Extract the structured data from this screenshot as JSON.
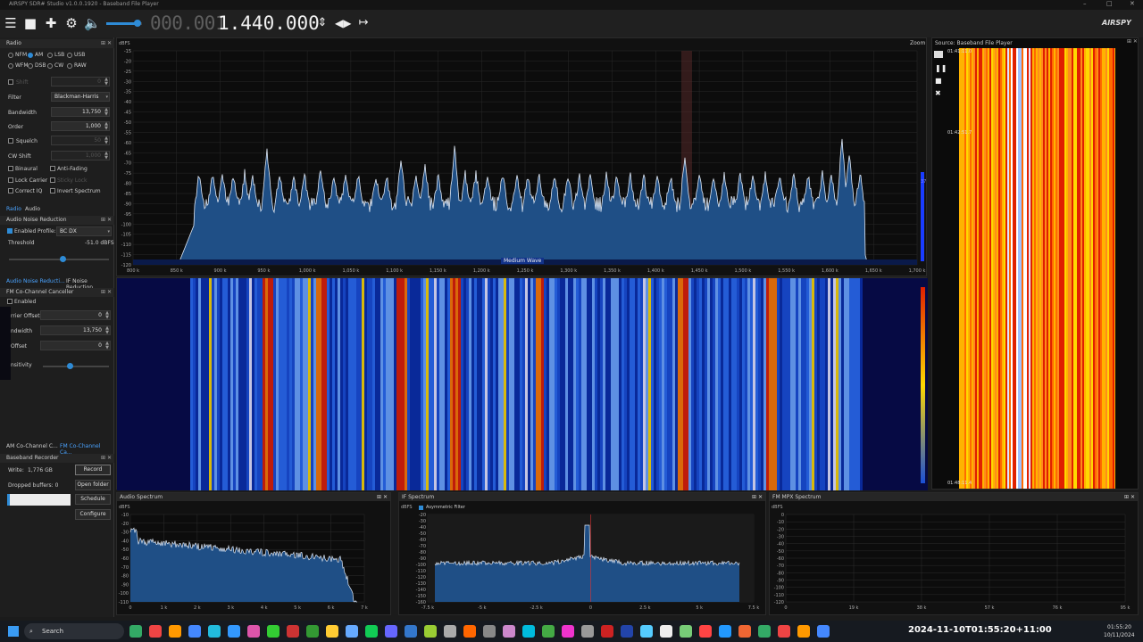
{
  "title": "AIRSPY SDR# Studio v1.0.0.1920 - Baseband File Player",
  "window": {
    "minimize": "–",
    "maximize": "□",
    "close": "✕"
  },
  "toolbar": {
    "freq_dim": "000.001",
    "freq_bright": "1.440.000",
    "icons": [
      "menu-icon",
      "stop-icon",
      "add-icon",
      "settings-icon",
      "speaker-icon",
      "updown-icon",
      "leftright-icon",
      "span-icon"
    ]
  },
  "logo": "AIRSPY",
  "radio": {
    "title": "Radio",
    "modes": [
      "NFM",
      "AM",
      "LSB",
      "USB",
      "WFM",
      "DSB",
      "CW",
      "RAW"
    ],
    "selected_mode": "AM",
    "shift_label": "Shift",
    "shift_value": "0",
    "filter_label": "Filter",
    "filter_value": "Blackman-Harris",
    "bandwidth_label": "Bandwidth",
    "bandwidth_value": "13,750",
    "order_label": "Order",
    "order_value": "1,000",
    "squelch_label": "Squelch",
    "squelch_value": "50",
    "cwshift_label": "CW Shift",
    "cwshift_value": "1,000",
    "binaural": "Binaural",
    "antifading": "Anti-Fading",
    "lockcarrier": "Lock Carrier",
    "stickylock": "Sticky Lock",
    "correctiq": "Correct IQ",
    "invertspectrum": "Invert Spectrum",
    "tab_radio": "Radio",
    "tab_audio": "Audio"
  },
  "anr": {
    "title": "Audio Noise Reduction",
    "enabled": "Enabled",
    "profile_label": "Profile:",
    "profile_value": "BC DX",
    "threshold_label": "Threshold",
    "threshold_value": "-51.0 dBFS",
    "threshold_level": 0.54,
    "tab_a": "Audio Noise Reducti...",
    "tab_b": "IF Noise Reduction"
  },
  "fmcc": {
    "title": "FM Co-Channel Canceller",
    "enabled": "Enabled",
    "carrier_offset_label": "rrier Offset",
    "carrier_offset_value": "0",
    "bandwidth_label": "ndwidth",
    "bandwidth_value": "13,750",
    "offset_label": "Offset",
    "offset_value": "0",
    "sensitivity_label": "nsitivity",
    "sensitivity_level": 0.4,
    "tab_a": "AM Co-Channel C...",
    "tab_b": "FM Co-Channel Ca..."
  },
  "recorder": {
    "title": "Baseband Recorder",
    "write_label": "Write:",
    "write_value": "1,776 GB",
    "record": "Record",
    "dropped_label": "Dropped buffers: 0",
    "open_folder": "Open folder",
    "schedule": "Schedule",
    "configure": "Configure"
  },
  "spectrum": {
    "ylabel": "dBFS",
    "zoom": "Zoom",
    "band_label": "Medium Wave",
    "y_ticks": [
      "-15",
      "-20",
      "-25",
      "-30",
      "-35",
      "-40",
      "-45",
      "-50",
      "-55",
      "-60",
      "-65",
      "-70",
      "-75",
      "-80",
      "-85",
      "-90",
      "-95",
      "-100",
      "-105",
      "-110",
      "-115",
      "-120"
    ],
    "x_ticks": [
      "800 k",
      "850 k",
      "900 k",
      "950 k",
      "1,000 k",
      "1,050 k",
      "1,100 k",
      "1,150 k",
      "1,200 k",
      "1,250 k",
      "1,300 k",
      "1,350 k",
      "1,400 k",
      "1,450 k",
      "1,500 k",
      "1,550 k",
      "1,600 k",
      "1,650 k",
      "1,700 k"
    ],
    "right_marker": "37"
  },
  "source": {
    "title": "Source: Baseband File Player",
    "time_1": "01:41:11.0",
    "time_2": "01:42:51.7",
    "time_3": "01:48:11.4"
  },
  "audio_spectrum": {
    "title": "Audio Spectrum",
    "ylabel": "dBFS",
    "y_ticks": [
      "-10",
      "-20",
      "-30",
      "-40",
      "-50",
      "-60",
      "-70",
      "-80",
      "-90",
      "-100",
      "-110"
    ],
    "x_ticks": [
      "0",
      "1 k",
      "2 k",
      "3 k",
      "4 k",
      "5 k",
      "6 k",
      "7 k"
    ]
  },
  "if_spectrum": {
    "title": "IF Spectrum",
    "ylabel": "dBFS",
    "asym": "Asymmetric Filter",
    "y_ticks": [
      "-20",
      "-30",
      "-40",
      "-50",
      "-60",
      "-70",
      "-80",
      "-90",
      "-100",
      "-110",
      "-120",
      "-130",
      "-140",
      "-150",
      "-160"
    ],
    "x_ticks": [
      "-7.5 k",
      "-5 k",
      "-2.5 k",
      "0",
      "2.5 k",
      "5 k",
      "7.5 k"
    ]
  },
  "mpx_spectrum": {
    "title": "FM MPX Spectrum",
    "ylabel": "dBFS",
    "y_ticks": [
      "0",
      "-10",
      "-20",
      "-30",
      "-40",
      "-50",
      "-60",
      "-70",
      "-80",
      "-90",
      "-100",
      "-110",
      "-120"
    ],
    "x_ticks": [
      "0",
      "19 k",
      "38 k",
      "57 k",
      "76 k",
      "95 k"
    ]
  },
  "taskbar": {
    "search": "Search",
    "timestamp": "2024-11-10T01:55:20+11:00",
    "clock_time": "01:55:20",
    "clock_date": "10/11/2024"
  },
  "colors": {
    "accent": "#2e8bd6",
    "spectrum_fill": "#1f5f9e",
    "background": "#111111"
  }
}
